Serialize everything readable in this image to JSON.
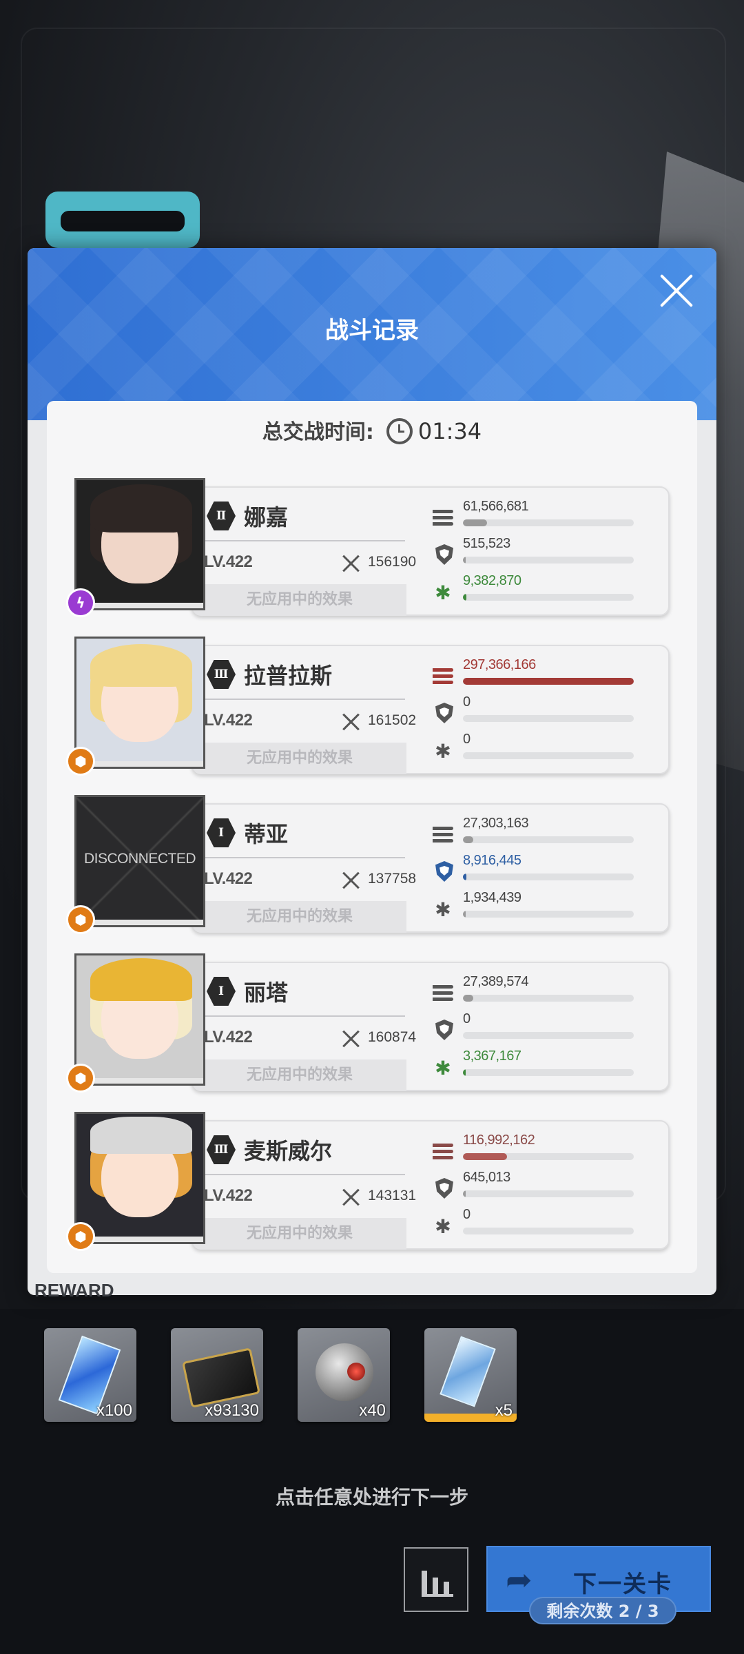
{
  "dialog": {
    "title": "战斗记录",
    "total_time_label": "总交战时间:",
    "total_time_value": "01:34"
  },
  "characters": [
    {
      "rank": "Ⅱ",
      "name": "娜嘉",
      "level": "LV.422",
      "power": "156190",
      "effects": "无应用中的效果",
      "burst_icon": "lightning-icon",
      "damage": "61,566,681",
      "damage_fraction": 0.14,
      "shield": "515,523",
      "shield_fraction": 0.01,
      "heal": "9,382,870",
      "heal_fraction": 0.02
    },
    {
      "rank": "Ⅲ",
      "name": "拉普拉斯",
      "level": "LV.422",
      "power": "161502",
      "effects": "无应用中的效果",
      "burst_icon": "hexagon-icon",
      "damage": "297,366,166",
      "damage_fraction": 1.0,
      "shield": "0",
      "shield_fraction": 0,
      "heal": "0",
      "heal_fraction": 0
    },
    {
      "rank": "Ⅰ",
      "name": "蒂亚",
      "level": "LV.422",
      "power": "137758",
      "effects": "无应用中的效果",
      "burst_icon": "hexagon-icon",
      "portrait_text": "DISCONNECTED",
      "damage": "27,303,163",
      "damage_fraction": 0.06,
      "shield": "8,916,445",
      "shield_fraction": 0.02,
      "heal": "1,934,439",
      "heal_fraction": 0.005
    },
    {
      "rank": "Ⅰ",
      "name": "丽塔",
      "level": "LV.422",
      "power": "160874",
      "effects": "无应用中的效果",
      "burst_icon": "hexagon-icon",
      "damage": "27,389,574",
      "damage_fraction": 0.06,
      "shield": "0",
      "shield_fraction": 0,
      "heal": "3,367,167",
      "heal_fraction": 0.008
    },
    {
      "rank": "Ⅲ",
      "name": "麦斯威尔",
      "level": "LV.422",
      "power": "143131",
      "effects": "无应用中的效果",
      "burst_icon": "hexagon-icon",
      "damage": "116,992,162",
      "damage_fraction": 0.26,
      "shield": "645,013",
      "shield_fraction": 0.01,
      "heal": "0",
      "heal_fraction": 0
    }
  ],
  "rewards": {
    "label": "REWARD",
    "items": [
      {
        "icon": "blue-crystal-icon",
        "qty": "x100"
      },
      {
        "icon": "credit-card-icon",
        "qty": "x93130"
      },
      {
        "icon": "core-orb-icon",
        "qty": "x40"
      },
      {
        "icon": "crystal-shard-icon",
        "qty": "x5"
      }
    ]
  },
  "footer": {
    "hint": "点击任意处进行下一步",
    "next_label": "下一关卡",
    "remaining": "剩余次数 2 / 3"
  },
  "colors": {
    "damage_dark": "#777777",
    "damage_top": "#a33a36",
    "shield_active": "#2e5fa3",
    "heal_active": "#3e8a3c",
    "header_blue": "#3a7ddd",
    "burst_purple": "#9a3bd2",
    "burst_orange": "#e07b16"
  }
}
